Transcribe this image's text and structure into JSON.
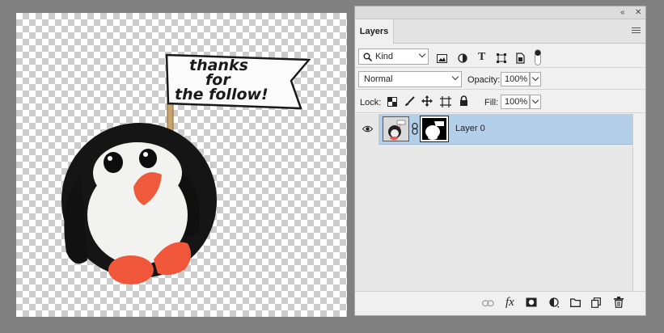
{
  "canvas": {
    "flag_lines": [
      "thanks",
      "for",
      "the follow!"
    ]
  },
  "panel": {
    "tab_label": "Layers",
    "filter": {
      "kind_label": "Kind"
    },
    "blend": {
      "mode": "Normal",
      "opacity_label": "Opacity:",
      "opacity_value": "100%"
    },
    "lock": {
      "label": "Lock:",
      "fill_label": "Fill:",
      "fill_value": "100%"
    },
    "layers": [
      {
        "name": "Layer 0",
        "visible": true,
        "selected": true
      }
    ],
    "icons": {
      "collapse": "double-chevron-icon",
      "close": "close-icon",
      "menu": "panel-menu-icon",
      "fx": "fx"
    }
  },
  "colors": {
    "selected_layer": "#b4cfea",
    "workspace": "#808080",
    "panel": "#f0f0f0"
  }
}
